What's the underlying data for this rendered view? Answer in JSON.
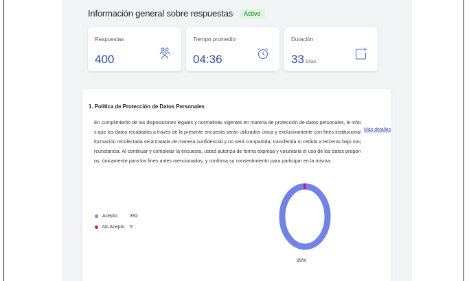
{
  "header": {
    "title": "Información general sobre respuestas",
    "status": "Activo"
  },
  "stats": [
    {
      "label": "Respuestas",
      "value": "400",
      "unit": "",
      "icon": "respondents-icon"
    },
    {
      "label": "Tiempo promedio",
      "value": "04:36",
      "unit": "",
      "icon": "alarm-clock-icon"
    },
    {
      "label": "Duración",
      "value": "33",
      "unit": "Días",
      "icon": "calendar-add-icon"
    }
  ],
  "question": {
    "title": "1. Política de Protección de Datos Personales",
    "description_lines": [
      "En cumplimiento de las disposiciones legales y normativas vigentes en materia de protección de datos personales, le informamo",
      "s que los datos recabados a través de la presente encuesta serán utilizados única y exclusivamente con fines institucionales. La in",
      "formación recolectada será tratada de manera confidencial y no será compartida, transferida ni cedida a terceros bajo ninguna ci",
      "rcunstancia. Al continuar y completar la encuesta, usted autoriza de forma expresa y voluntaria el uso de los datos proporcionad",
      "os, únicamente para los fines antes mencionados, y confirma su consentimiento para participar en la misma."
    ],
    "more_link": "Más detalles",
    "options": [
      {
        "label": "Acepto",
        "count": "392",
        "color": "#6f83e8"
      },
      {
        "label": "No Acepto",
        "count": "5",
        "color": "#d4127a"
      }
    ],
    "percent_label": "99%"
  },
  "colors": {
    "accent": "#2b4bb3",
    "badge_bg": "#dff6dd",
    "badge_text": "#0f7a2b"
  }
}
